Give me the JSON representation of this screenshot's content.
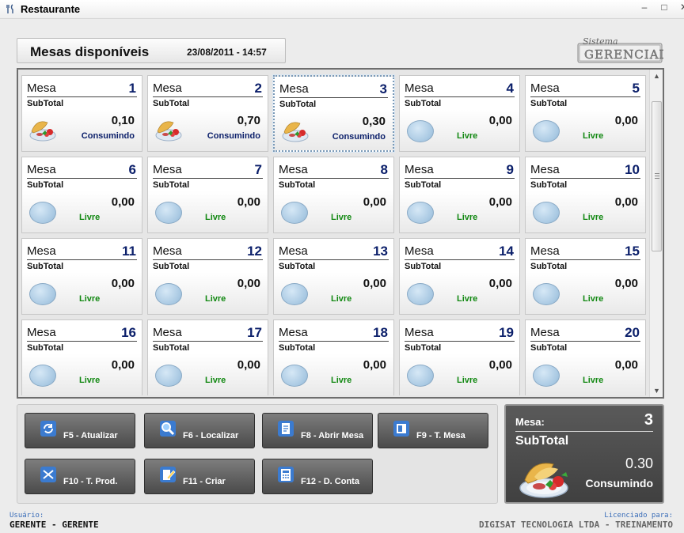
{
  "window": {
    "title": "Restaurante",
    "min_glyph": "–",
    "max_glyph": "□",
    "close_glyph": "✕"
  },
  "header": {
    "title": "Mesas disponíveis",
    "datetime": "23/08/2011  -  14:57"
  },
  "logo": {
    "line1": "Sistema",
    "line2": "GERENCIAL"
  },
  "tables": [
    {
      "label": "Mesa",
      "number": "1",
      "subtotal_label": "SubTotal",
      "value": "0,10",
      "status": "Consumindo"
    },
    {
      "label": "Mesa",
      "number": "2",
      "subtotal_label": "SubTotal",
      "value": "0,70",
      "status": "Consumindo"
    },
    {
      "label": "Mesa",
      "number": "3",
      "subtotal_label": "SubTotal",
      "value": "0,30",
      "status": "Consumindo",
      "selected": true
    },
    {
      "label": "Mesa",
      "number": "4",
      "subtotal_label": "SubTotal",
      "value": "0,00",
      "status": "Livre"
    },
    {
      "label": "Mesa",
      "number": "5",
      "subtotal_label": "SubTotal",
      "value": "0,00",
      "status": "Livre"
    },
    {
      "label": "Mesa",
      "number": "6",
      "subtotal_label": "SubTotal",
      "value": "0,00",
      "status": "Livre"
    },
    {
      "label": "Mesa",
      "number": "7",
      "subtotal_label": "SubTotal",
      "value": "0,00",
      "status": "Livre"
    },
    {
      "label": "Mesa",
      "number": "8",
      "subtotal_label": "SubTotal",
      "value": "0,00",
      "status": "Livre"
    },
    {
      "label": "Mesa",
      "number": "9",
      "subtotal_label": "SubTotal",
      "value": "0,00",
      "status": "Livre"
    },
    {
      "label": "Mesa",
      "number": "10",
      "subtotal_label": "SubTotal",
      "value": "0,00",
      "status": "Livre"
    },
    {
      "label": "Mesa",
      "number": "11",
      "subtotal_label": "SubTotal",
      "value": "0,00",
      "status": "Livre"
    },
    {
      "label": "Mesa",
      "number": "12",
      "subtotal_label": "SubTotal",
      "value": "0,00",
      "status": "Livre"
    },
    {
      "label": "Mesa",
      "number": "13",
      "subtotal_label": "SubTotal",
      "value": "0,00",
      "status": "Livre"
    },
    {
      "label": "Mesa",
      "number": "14",
      "subtotal_label": "SubTotal",
      "value": "0,00",
      "status": "Livre"
    },
    {
      "label": "Mesa",
      "number": "15",
      "subtotal_label": "SubTotal",
      "value": "0,00",
      "status": "Livre"
    },
    {
      "label": "Mesa",
      "number": "16",
      "subtotal_label": "SubTotal",
      "value": "0,00",
      "status": "Livre"
    },
    {
      "label": "Mesa",
      "number": "17",
      "subtotal_label": "SubTotal",
      "value": "0,00",
      "status": "Livre"
    },
    {
      "label": "Mesa",
      "number": "18",
      "subtotal_label": "SubTotal",
      "value": "0,00",
      "status": "Livre"
    },
    {
      "label": "Mesa",
      "number": "19",
      "subtotal_label": "SubTotal",
      "value": "0,00",
      "status": "Livre"
    },
    {
      "label": "Mesa",
      "number": "20",
      "subtotal_label": "SubTotal",
      "value": "0,00",
      "status": "Livre"
    }
  ],
  "fkeys": [
    {
      "label": "F5 - Atualizar",
      "icon": "refresh-icon"
    },
    {
      "label": "F6 - Localizar",
      "icon": "magnifier-icon"
    },
    {
      "label": "F8 - Abrir Mesa",
      "icon": "document-open-icon"
    },
    {
      "label": "F9 - T. Mesa",
      "icon": "transfer-table-icon"
    },
    {
      "label": "F10 - T. Prod.",
      "icon": "transfer-product-icon"
    },
    {
      "label": "F11 - Criar",
      "icon": "create-edit-icon"
    },
    {
      "label": "F12 - D. Conta",
      "icon": "calculator-icon"
    }
  ],
  "summary": {
    "mesa_label": "Mesa:",
    "mesa_number": "3",
    "subtotal_label": "SubTotal",
    "value": "0.30",
    "status": "Consumindo"
  },
  "statusbar": {
    "user_label": "Usuário:",
    "user": "GERENTE - GERENTE",
    "license_label": "Licenciado para:",
    "license": "DIGISAT TECNOLOGIA LTDA - TREINAMENTO"
  },
  "colors": {
    "number_blue": "#0b1f6a",
    "livre_green": "#118811",
    "button_dark": "#4a4a4a"
  }
}
